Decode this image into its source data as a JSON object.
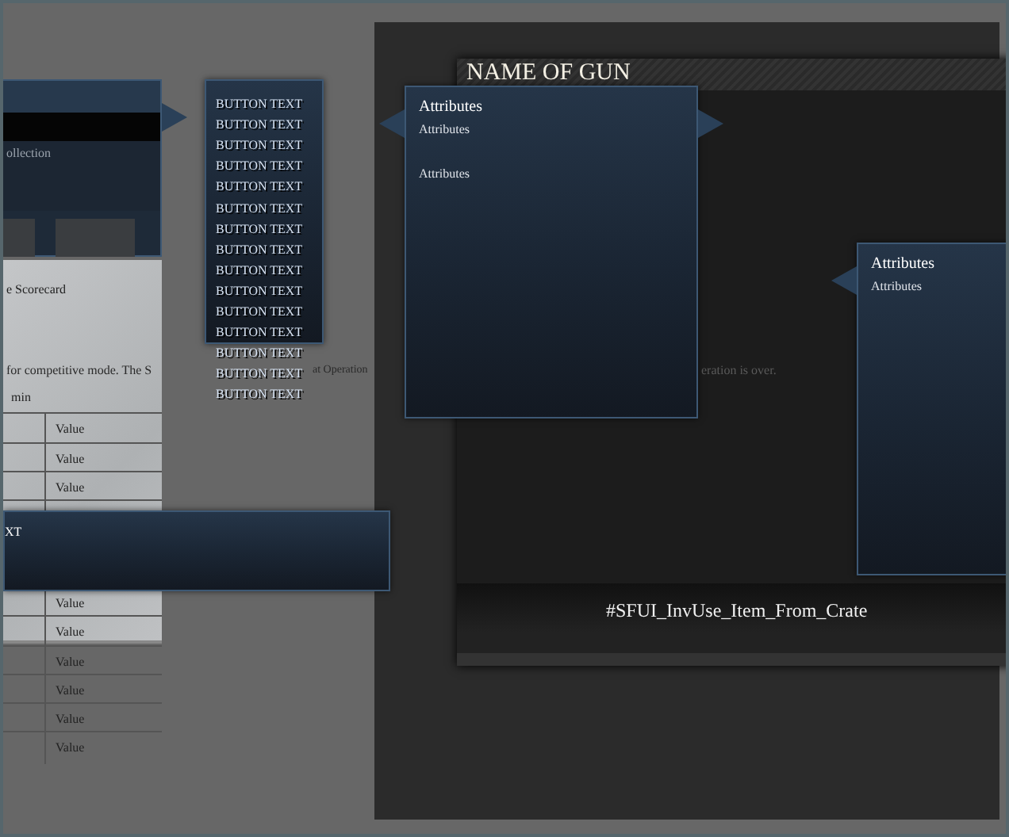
{
  "collection_panel": {
    "subtitle": "ollection"
  },
  "scorecard": {
    "title": "e Scorecard",
    "description": "for competitive mode.  The S",
    "description_tail": "at Operation",
    "duration": "min",
    "values": [
      "Value",
      "Value",
      "Value",
      "Value",
      "Value",
      "Value",
      "Value",
      "Value",
      "Value"
    ]
  },
  "button_list": [
    "BUTTON TEXT",
    "BUTTON TEXT",
    "BUTTON TEXT",
    "BUTTON TEXT",
    "BUTTON TEXT",
    "BUTTON TEXT",
    "BUTTON TEXT",
    "BUTTON TEXT",
    "BUTTON TEXT",
    "BUTTON TEXT",
    "BUTTON TEXT",
    "BUTTON TEXT",
    "BUTTON TEXT",
    "BUTTON TEXT",
    "BUTTON TEXT"
  ],
  "banner": {
    "text": "XT"
  },
  "gun_window": {
    "title": "NAME OF GUN",
    "background_text": "eration is over.",
    "footer": "#SFUI_InvUse_Item_From_Crate"
  },
  "tooltips": [
    {
      "title": "Attributes",
      "subtitle": "Attributes",
      "body": "Attributes"
    },
    {
      "title": "Attributes",
      "subtitle": "Attributes"
    }
  ]
}
